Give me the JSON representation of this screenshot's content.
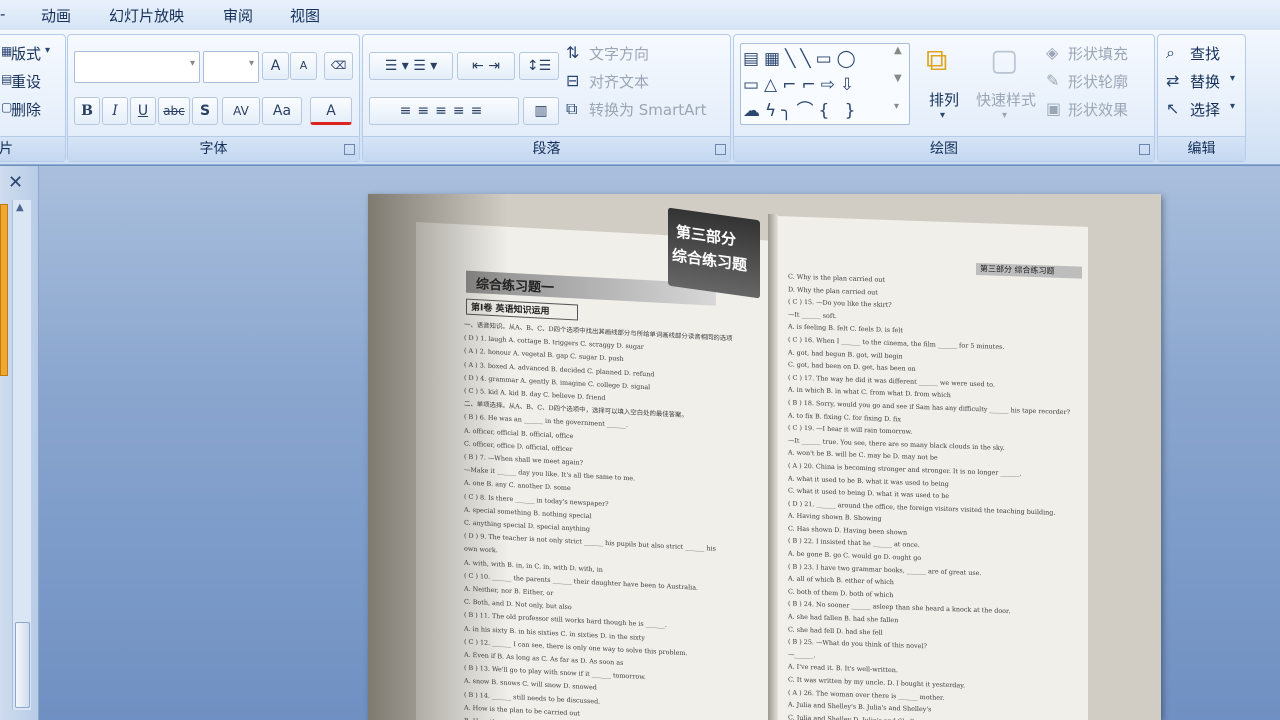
{
  "menu": {
    "tabs": [
      "动画",
      "幻灯片放映",
      "审阅",
      "视图"
    ]
  },
  "slides_group": {
    "layout": "版式",
    "reset": "重设",
    "delete": "删除",
    "title": "片"
  },
  "font_group": {
    "title": "字体",
    "grow": "A",
    "shrink": "A",
    "bold": "B",
    "italic": "I",
    "underline": "U",
    "strike": "abc",
    "shadow": "S",
    "spacing": "AV",
    "case": "Aa",
    "color": "A"
  },
  "paragraph_group": {
    "title": "段落",
    "text_direction": "文字方向",
    "align_text": "对齐文本",
    "smartart": "转换为 SmartArt"
  },
  "drawing_group": {
    "title": "绘图",
    "arrange": "排列",
    "quick_styles": "快速样式",
    "shape_fill": "形状填充",
    "shape_outline": "形状轮廓",
    "shape_effects": "形状效果"
  },
  "editing_group": {
    "title": "编辑",
    "find": "查找",
    "replace": "替换",
    "select": "选择"
  },
  "pane": {
    "close": "✕"
  },
  "book": {
    "banner_line1": "第三部分",
    "banner_line2": "综合练习题",
    "left_heading": "综合练习题一",
    "left_subheading": "第Ⅰ卷  英语知识运用",
    "right_header": "第三部分  综合练习题",
    "left_lines": [
      "一、语音知识。从A、B、C、D四个选项中找出其画线部分与所给单词画线部分读音相同的选项",
      "( D ) 1. laugh     A. cottage     B. triggers     C. scraggy     D. sugar",
      "( A ) 2. honour    A. vegetal     B. gap          C. sugar        D. push",
      "( A ) 3. boxed     A. advanced    B. decided      C. planned      D. refund",
      "( D ) 4. grammar   A. gently      B. imagine      C. college      D. signal",
      "( C ) 5. kid       A. kid         B. day          C. believe      D. friend",
      "二、单项选择。从A、B、C、D四个选项中，选择可以填入空白处的最佳答案。",
      "( B ) 6. He was an ______ in the government ______.",
      "      A. officer, official        B. official, office",
      "      C. officer, office          D. official, officer",
      "( B ) 7. —When shall we meet again?",
      "      —Make it ______ day you like. It's all the same to me.",
      "      A. one       B. any       C. another       D. some",
      "( C ) 8. Is there ______ in today's newspaper?",
      "      A. special something        B. nothing special",
      "      C. anything special         D. special anything",
      "( D ) 9. The teacher is not only strict ______ his pupils but also strict ______ his",
      "      own work.",
      "      A. with, with     B. in, in     C. in, with     D. with, in",
      "( C ) 10. ______ the parents ______ their daughter have been to Australia.",
      "      A. Neither, nor             B. Either, or",
      "      C. Both, and                D. Not only, but also",
      "( B ) 11. The old professor still works hard though he is ______.",
      "      A. in his sixty     B. in his sixties     C. in sixties     D. in the sixty",
      "( C ) 12. ______ I can see, there is only one way to solve this problem.",
      "      A. Even if     B. As long as     C. As far as     D. As soon as",
      "( B ) 13. We'll go to play with snow if it ______ tomorrow.",
      "      A. snow     B. snows     C. will snow     D. snowed",
      "( B ) 14. ______ still needs to be discussed.",
      "      A. How is the plan to be carried out",
      "      B. How the plan is to be carried out"
    ],
    "right_lines": [
      "      C. Why is the plan carried out",
      "      D. Why the plan carried out",
      "( C ) 15. —Do you like the skirt?",
      "      —It ______ soft.",
      "      A. is feeling     B. felt     C. feels     D. is felt",
      "( C ) 16. When I ______ to the cinema, the film ______ for 5 minutes.",
      "      A. got, had begun           B. got, will begin",
      "      C. got, had been on         D. get, has been on",
      "( C ) 17. The way he did it was different ______ we were used to.",
      "      A. in which     B. in what     C. from what     D. from which",
      "( B ) 18. Sorry, would you go and see if Sam has any difficulty ______ his tape recorder?",
      "      A. to fix     B. fixing     C. for fixing     D. fix",
      "( C ) 19. —I hear it will rain tomorrow.",
      "      —It ______ true. You see, there are so many black clouds in the sky.",
      "      A. won't be     B. will be     C. may be     D. may not be",
      "( A ) 20. China is becoming stronger and stronger. It is no longer ______.",
      "      A. what it used to be       B. what it was used to being",
      "      C. what it used to being    D. what it was used to be",
      "( D ) 21. ______ around the office, the foreign visitors visited the teaching building.",
      "      A. Having shown             B. Showing",
      "      C. Has shown                D. Having been shown",
      "( B ) 22. I insisted that he ______ at once.",
      "      A. be gone     B. go     C. would go     D. ought go",
      "( B ) 23. I have two grammar books, ______ are of great use.",
      "      A. all of which             B. either of which",
      "      C. both of them             D. both of which",
      "( B ) 24. No sooner ______ asleep than she heard a knock at the door.",
      "      A. she had fallen           B. had she fallen",
      "      C. she had fell             D. had she fell",
      "( B ) 25. —What do you think of this novel?",
      "      —______.",
      "      A. I've read it.            B. It's well-written.",
      "      C. It was written by my uncle.   D. I bought it yesterday.",
      "( A ) 26. The woman over there is ______ mother.",
      "      A. Julia and Shelley's      B. Julia's and Shelley's",
      "      C. Julia and Shelley        D. Julia's and Shelley"
    ]
  }
}
